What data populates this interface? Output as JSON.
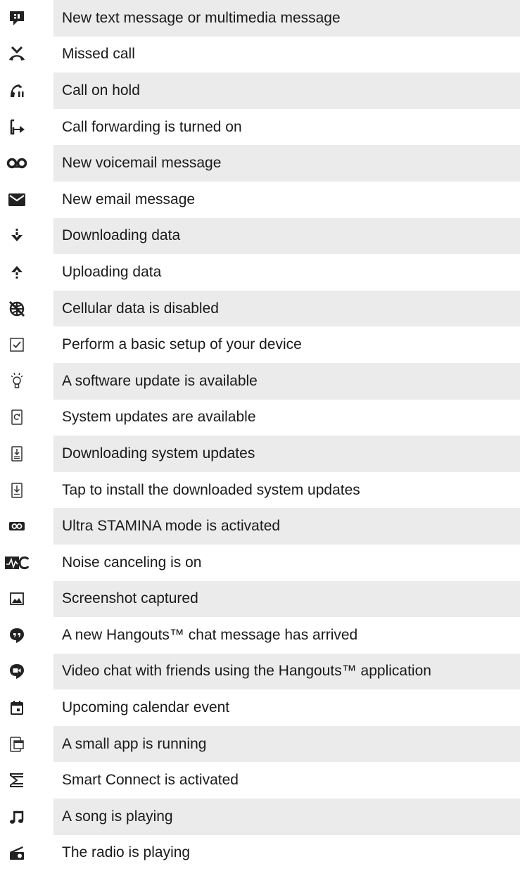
{
  "notifications": [
    {
      "icon": "text-message-icon",
      "label": "New text message or multimedia message"
    },
    {
      "icon": "missed-call-icon",
      "label": "Missed call"
    },
    {
      "icon": "call-on-hold-icon",
      "label": "Call on hold"
    },
    {
      "icon": "call-forwarding-icon",
      "label": "Call forwarding is turned on"
    },
    {
      "icon": "voicemail-icon",
      "label": "New voicemail message"
    },
    {
      "icon": "email-icon",
      "label": "New email message"
    },
    {
      "icon": "download-icon",
      "label": "Downloading data"
    },
    {
      "icon": "upload-icon",
      "label": "Uploading data"
    },
    {
      "icon": "cellular-data-disabled-icon",
      "label": "Cellular data is disabled"
    },
    {
      "icon": "checkbox-icon",
      "label": "Perform a basic setup of your device"
    },
    {
      "icon": "lightbulb-icon",
      "label": "A software update is available"
    },
    {
      "icon": "system-update-icon",
      "label": "System updates are available"
    },
    {
      "icon": "downloading-update-icon",
      "label": "Downloading system updates"
    },
    {
      "icon": "install-update-icon",
      "label": "Tap to install the downloaded system updates"
    },
    {
      "icon": "ultra-stamina-icon",
      "label": "Ultra STAMINA mode is activated"
    },
    {
      "icon": "noise-canceling-icon",
      "label": "Noise canceling is on"
    },
    {
      "icon": "screenshot-icon",
      "label": "Screenshot captured"
    },
    {
      "icon": "hangouts-chat-icon",
      "label": "A new Hangouts™ chat message has arrived"
    },
    {
      "icon": "hangouts-video-icon",
      "label": "Video chat with friends using the Hangouts™ application"
    },
    {
      "icon": "calendar-icon",
      "label": "Upcoming calendar event"
    },
    {
      "icon": "small-app-icon",
      "label": "A small app is running"
    },
    {
      "icon": "smart-connect-icon",
      "label": "Smart Connect is activated"
    },
    {
      "icon": "music-note-icon",
      "label": "A song is playing"
    },
    {
      "icon": "radio-icon",
      "label": "The radio is playing"
    }
  ]
}
